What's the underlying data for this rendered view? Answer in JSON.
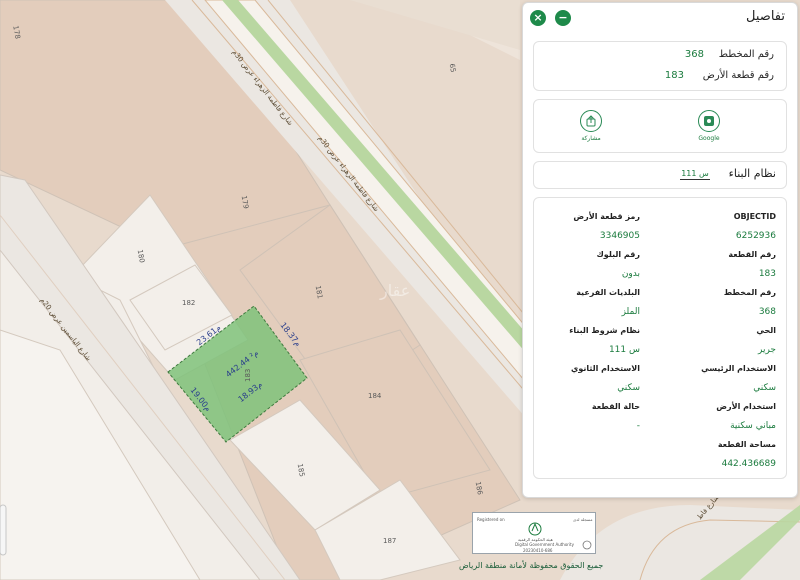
{
  "panel": {
    "title": "تفاصيل",
    "close_glyph": "×",
    "minimize_glyph": "−",
    "summary": {
      "plan_label": "رقم المخطط",
      "plan_value": "368",
      "parcel_label": "رقم قطعة الأرض",
      "parcel_value": "183"
    },
    "actions": {
      "google_label": "Google",
      "share_label": "مشاركة",
      "google_icon": "map-icon",
      "share_icon": "share-icon"
    },
    "building_system": {
      "label": "نظام البناء",
      "value": "س 111"
    },
    "attributes": {
      "objectid_label": "OBJECTID",
      "objectid_value": "6252936",
      "parcel_code_label": "رمز قطعة الأرض",
      "parcel_code_value": "3346905",
      "parcel_no_label": "رقم القطعة",
      "parcel_no_value": "183",
      "block_label": "رقم البلوك",
      "block_value": "بدون",
      "plan_label": "رقم المخطط",
      "plan_value": "368",
      "sub_muni_label": "البلديات الفرعية",
      "sub_muni_value": "الملز",
      "district_label": "الحي",
      "district_value": "جرير",
      "conditions_label": "نظام شروط البناء",
      "conditions_value": "س 111",
      "main_use_label": "الاستخدام الرئيسي",
      "main_use_value": "سكني",
      "sec_use_label": "الاستخدام الثانوي",
      "sec_use_value": "سكني",
      "land_use_label": "استخدام الأرض",
      "land_use_value": "مباني سكنية",
      "status_label": "حالة القطعة",
      "status_value": "-",
      "area_label": "مساحة القطعة",
      "area_value": "442.436689"
    }
  },
  "map": {
    "parcel_numbers": [
      "178",
      "65",
      "179",
      "180",
      "181",
      "182",
      "183",
      "184",
      "185",
      "186",
      "187"
    ],
    "road_labels": [
      "شارع فاطمة الزهراء عرض 30م",
      "شارع فاطمة الزهراء عرض 30م",
      "شارع الياسمين عرض 20م",
      "شارع فاط"
    ],
    "dimensions": {
      "north": "23.61م",
      "east": "18.37م",
      "south": "18.93م",
      "west": "19.00م",
      "area": "442.44 م²"
    },
    "watermark": "عقار",
    "highlight_color": "#7fc27a",
    "median_color": "#b9d7a1",
    "logo": {
      "registered": "Registered on",
      "issued": "مسجلة لدى",
      "name_ar": "هيئة الحكومة الرقمية",
      "name_en": "Digital Government Authority",
      "code": "20230410-686"
    },
    "copyright": "جميع الحقوق محفوظة لأمانة منطقة الرياض"
  }
}
